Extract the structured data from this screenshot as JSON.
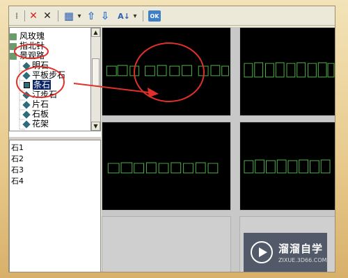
{
  "toolbar": {
    "buttons": [
      {
        "name": "delete-red-button",
        "glyph": "✕",
        "color": "#d22020"
      },
      {
        "name": "delete-black-button",
        "glyph": "✕",
        "color": "#222222"
      },
      {
        "name": "view-grid-button",
        "glyph": "▦",
        "color": "#2f5fb3"
      },
      {
        "name": "view-dropdown-button",
        "glyph": "▾",
        "color": "#333333"
      },
      {
        "name": "move-up-button",
        "glyph": "⇧",
        "color": "#2f6fd0"
      },
      {
        "name": "move-down-button",
        "glyph": "⇩",
        "color": "#2f6fd0"
      },
      {
        "name": "sort-az-button",
        "glyph": "A↓",
        "color": "#2f5fb3"
      },
      {
        "name": "sort-dropdown-button",
        "glyph": "▾",
        "color": "#333333"
      },
      {
        "name": "ok-button",
        "glyph": "OK",
        "color": "#ffffff"
      }
    ]
  },
  "tree": {
    "items": [
      {
        "label": "风玫瑰",
        "icon": "folder-icon"
      },
      {
        "label": "指北针",
        "icon": "folder-icon"
      },
      {
        "label": "景观路",
        "icon": "folder-icon"
      },
      {
        "label": "明石",
        "icon": "stone-icon"
      },
      {
        "label": "平板步石",
        "icon": "stone-icon"
      },
      {
        "label": "条石",
        "icon": "stone-icon",
        "selected": true
      },
      {
        "label": "汀步石",
        "icon": "stone-icon"
      },
      {
        "label": "片石",
        "icon": "stone-icon"
      },
      {
        "label": "石板",
        "icon": "stone-icon"
      },
      {
        "label": "花架",
        "icon": "stone-icon"
      }
    ]
  },
  "list": {
    "items": [
      "石1",
      "石2",
      "石3",
      "石4"
    ]
  },
  "watermark": {
    "title": "溜溜自学",
    "url": "ZIXUE.3D66.COM"
  },
  "colors": {
    "accent_red": "#e0302a",
    "shape_green": "#4fb24a",
    "selection": "#0a246a"
  }
}
